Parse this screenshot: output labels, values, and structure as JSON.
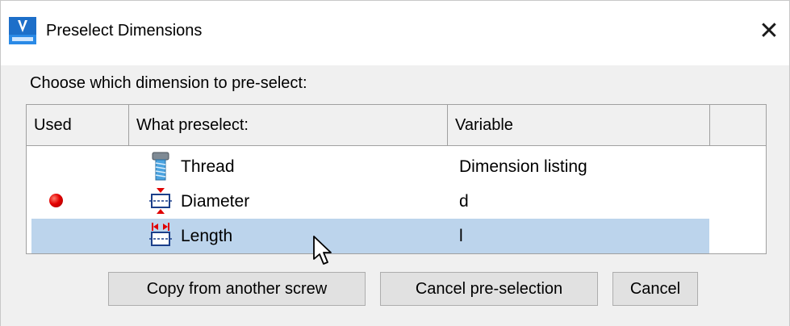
{
  "window": {
    "title": "Preselect Dimensions",
    "close_glyph": "✕",
    "icon": "app-logo-icon"
  },
  "prompt": "Choose which dimension to pre-select:",
  "table": {
    "columns": [
      "Used",
      "What preselect:",
      "Variable",
      ""
    ],
    "rows": [
      {
        "used": false,
        "icon": "thread-bolt-icon",
        "what": "Thread",
        "variable": "Dimension listing",
        "selected": false
      },
      {
        "used": true,
        "icon": "diameter-dimension-icon",
        "what": "Diameter",
        "variable": "d",
        "selected": false
      },
      {
        "used": false,
        "icon": "length-dimension-icon",
        "what": "Length",
        "variable": "l",
        "selected": true
      }
    ]
  },
  "buttons": {
    "copy": "Copy from another screw",
    "cancel_preselection": "Cancel pre-selection",
    "cancel": "Cancel"
  },
  "colors": {
    "selection": "#bcd4ec",
    "used_marker": "#e30000",
    "dimension_arrow": "#e00000"
  }
}
